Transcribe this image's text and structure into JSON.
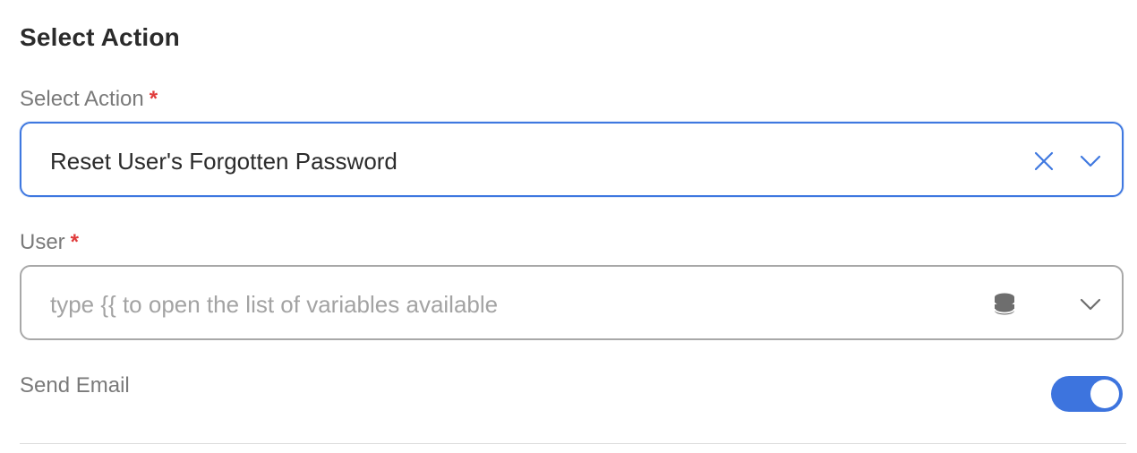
{
  "section": {
    "title": "Select Action"
  },
  "action_field": {
    "label": "Select Action",
    "required_marker": "*",
    "value": "Reset User's Forgotten Password",
    "clear_icon": "close-icon",
    "dropdown_icon": "chevron-down-icon",
    "border_color": "#3f78e0"
  },
  "user_field": {
    "label": "User",
    "required_marker": "*",
    "placeholder": "type {{ to open the list of variables available",
    "variable_icon": "database-icon",
    "dropdown_icon": "chevron-down-icon"
  },
  "send_email": {
    "label": "Send Email",
    "enabled": true,
    "toggle_color": "#3d74de"
  }
}
